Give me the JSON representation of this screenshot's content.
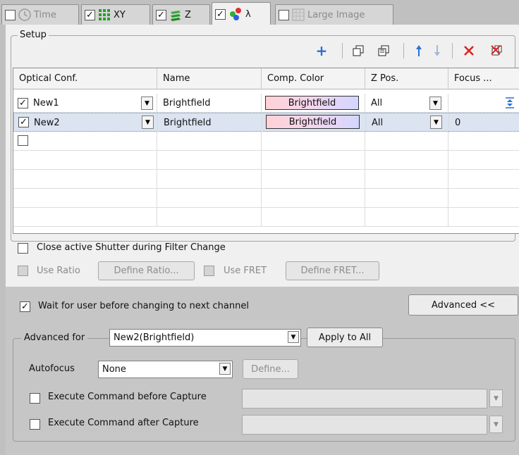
{
  "tabs": [
    {
      "label": "Time",
      "checked": false,
      "disabled": true
    },
    {
      "label": "XY",
      "checked": true
    },
    {
      "label": "Z",
      "checked": true
    },
    {
      "label": "λ",
      "checked": true,
      "active": true
    },
    {
      "label": "Large Image",
      "checked": false,
      "disabled": true
    }
  ],
  "setup": {
    "title": "Setup",
    "toolbar_icons": [
      "add-icon",
      "copy-icon",
      "paste-icon",
      "move-up-icon",
      "move-down-icon",
      "delete-icon",
      "delete-all-icon"
    ],
    "columns": [
      "Optical Conf.",
      "Name",
      "Comp. Color",
      "Z Pos.",
      "Focus ..."
    ],
    "rows": [
      {
        "checked": true,
        "optical_conf": "New1",
        "name": "Brightfield",
        "comp_color": "Brightfield",
        "z_pos": "All",
        "focus": ""
      },
      {
        "checked": true,
        "optical_conf": "New2",
        "name": "Brightfield",
        "comp_color": "Brightfield",
        "z_pos": "All",
        "focus": "0"
      }
    ],
    "close_shutter_label": "Close active Shutter during Filter Change",
    "use_ratio_label": "Use Ratio",
    "define_ratio_label": "Define Ratio...",
    "use_fret_label": "Use FRET",
    "define_fret_label": "Define FRET..."
  },
  "advanced": {
    "wait_label": "Wait for user before changing to next channel",
    "toggle_label": "Advanced <<",
    "advanced_for_label": "Advanced for",
    "advanced_for_value": "New2(Brightfield)",
    "apply_all_label": "Apply to All",
    "autofocus_label": "Autofocus",
    "autofocus_value": "None",
    "define_label": "Define...",
    "exec_before_label": "Execute Command before Capture",
    "exec_after_label": "Execute Command after Capture"
  },
  "colors": {
    "delete": "#e02020",
    "add": "#2a6fd6",
    "selected_row": "#dbe4f0"
  }
}
